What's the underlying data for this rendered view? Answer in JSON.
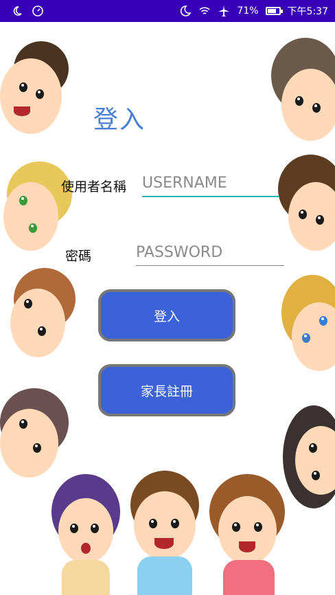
{
  "status_bar": {
    "battery_percent": "71%",
    "time": "下午5:37",
    "icons": [
      "moon-icon",
      "speedometer-icon",
      "night-mode-icon",
      "wifi-icon",
      "airplane-icon",
      "battery-icon"
    ]
  },
  "login": {
    "title": "登入",
    "username_label": "使用者名稱",
    "username_placeholder": "USERNAME",
    "password_label": "密碼",
    "password_placeholder": "PASSWORD",
    "login_button": "登入",
    "register_button": "家長註冊"
  },
  "colors": {
    "status_bar": "#3a00b8",
    "title": "#4a7fd6",
    "button": "#3b62d6",
    "focused_line": "#26b5b5"
  }
}
